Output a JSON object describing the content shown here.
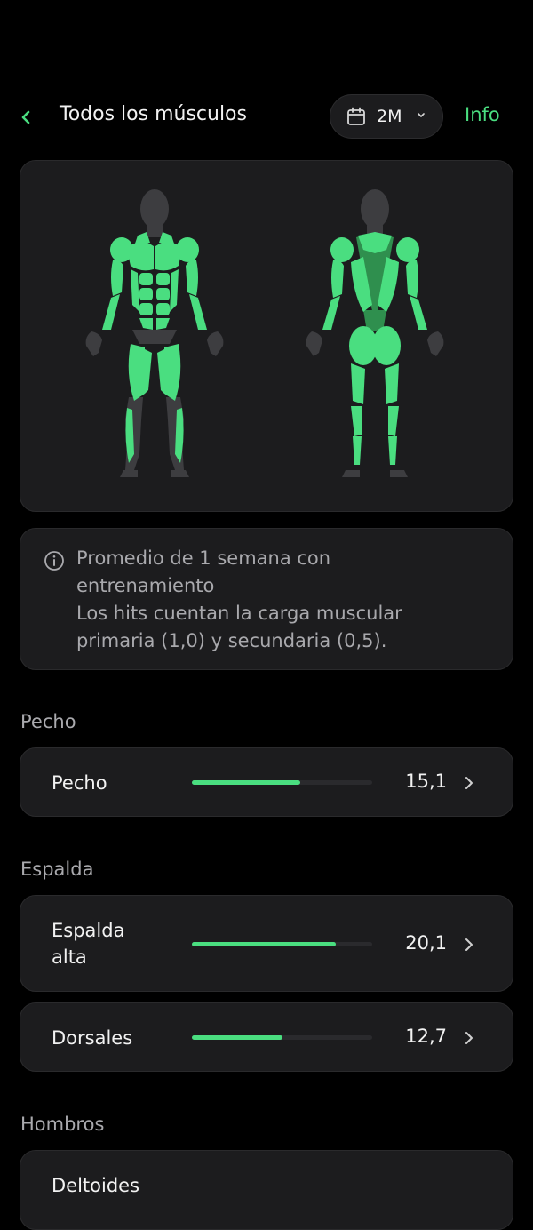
{
  "header": {
    "title": "Todos los músculos",
    "period": "2M",
    "info_label": "Info"
  },
  "colors": {
    "accent": "#4ade80",
    "muscle_active": "#4ade80",
    "muscle_dark": "#2f8f4e",
    "muscle_inactive": "#3d3d40",
    "card": "#1c1c1e",
    "background": "#000000"
  },
  "info_note": {
    "lines": [
      "Promedio de 1 semana con",
      "entrenamiento",
      "Los hits cuentan la carga muscular",
      "primaria (1,0) y secundaria (0,5)."
    ]
  },
  "sections": [
    {
      "title": "Pecho",
      "rows": [
        {
          "label_lines": [
            "Pecho"
          ],
          "value": "15,1",
          "level": 0.6
        }
      ]
    },
    {
      "title": "Espalda",
      "rows": [
        {
          "label_lines": [
            "Espalda",
            "alta"
          ],
          "value": "20,1",
          "level": 0.8
        },
        {
          "label_lines": [
            "Dorsales"
          ],
          "value": "12,7",
          "level": 0.5
        }
      ]
    },
    {
      "title": "Hombros",
      "rows": [
        {
          "label_lines": [
            "Deltoides"
          ],
          "value": "",
          "level": 0
        }
      ]
    }
  ]
}
